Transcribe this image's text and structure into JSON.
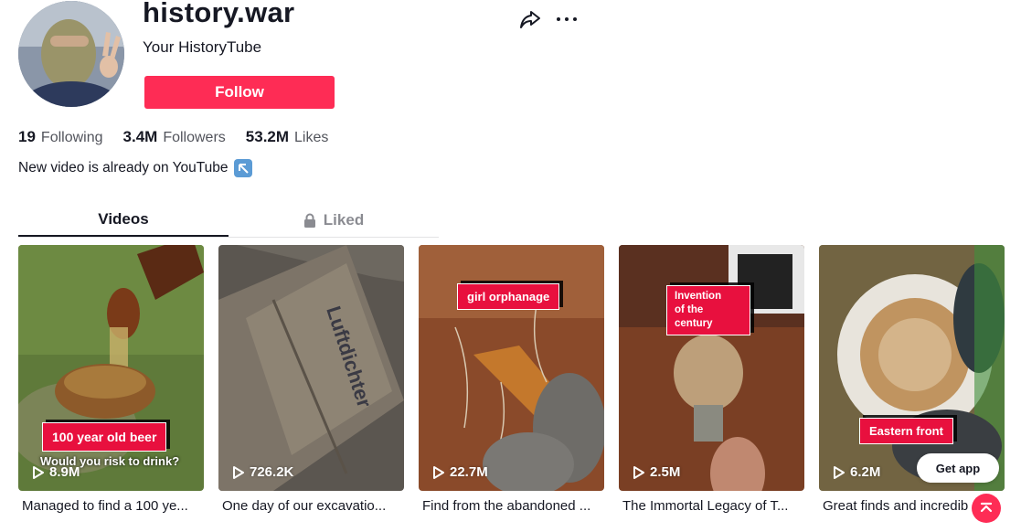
{
  "profile": {
    "username": "history.war",
    "nickname": "Your HistoryTube",
    "follow_label": "Follow",
    "bio": "New video is already on YouTube",
    "bio_emoji": "up-left-arrow-icon"
  },
  "stats": [
    {
      "number": "19",
      "label": "Following"
    },
    {
      "number": "3.4M",
      "label": "Followers"
    },
    {
      "number": "53.2M",
      "label": "Likes"
    }
  ],
  "tabs": [
    {
      "label": "Videos",
      "active": true
    },
    {
      "label": "Liked",
      "active": false,
      "icon": "lock-icon"
    }
  ],
  "videos": [
    {
      "views": "8.9M",
      "caption": "Managed to find a 100 ye...",
      "badge": "100 year old beer",
      "overlay_text": "Would you risk to drink?"
    },
    {
      "views": "726.2K",
      "caption": "One day of our excavatio...",
      "overlay_text": "Luftdichter"
    },
    {
      "views": "22.7M",
      "caption": "Find from the abandoned ...",
      "badge": "girl orphanage"
    },
    {
      "views": "2.5M",
      "caption": "The Immortal Legacy of T...",
      "badge": "Invention",
      "badge_line2": "of the century"
    },
    {
      "views": "6.2M",
      "caption": "Great finds and incredib",
      "badge": "Eastern front"
    }
  ],
  "floating": {
    "get_app_label": "Get app",
    "scroll_top_icon": "arrow-up-icon"
  },
  "colors": {
    "accent": "#fe2c55",
    "text": "#161823",
    "badge": "#e8103e"
  }
}
